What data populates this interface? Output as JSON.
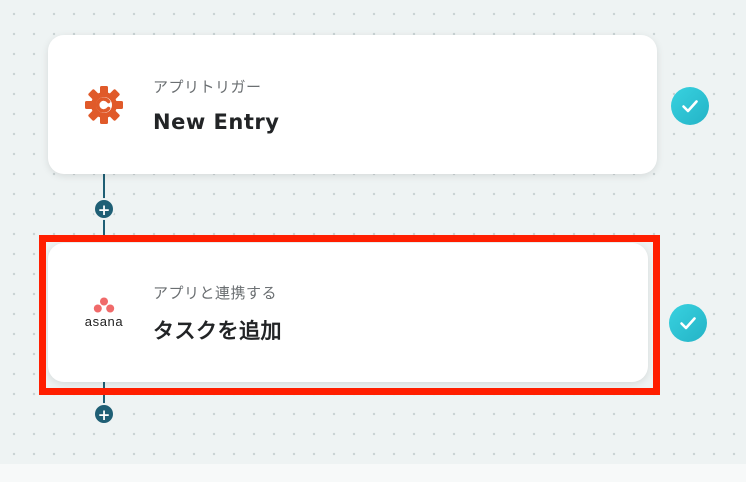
{
  "steps": [
    {
      "subtitle": "アプリトリガー",
      "title": "New Entry",
      "icon": "cognito-forms-gear-icon",
      "icon_color": "#e05a2a",
      "status": "completed"
    },
    {
      "subtitle": "アプリと連携する",
      "title": "タスクを追加",
      "icon": "asana-logo",
      "icon_text": "asana",
      "icon_color": "#f06a6a",
      "status": "completed"
    }
  ],
  "add_step_label": "+",
  "colors": {
    "connector": "#1f5f75",
    "check": "#2ec4d6",
    "highlight": "#ff1e00"
  }
}
